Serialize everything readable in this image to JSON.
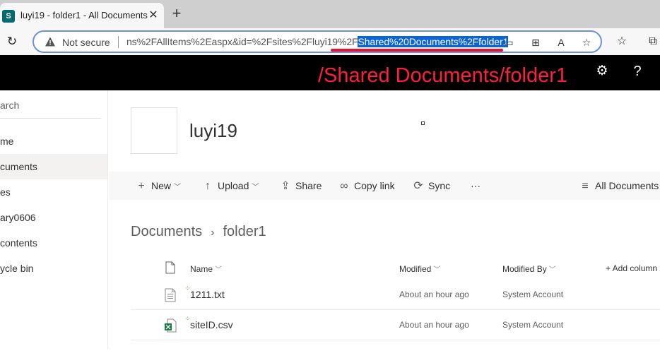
{
  "browser": {
    "tab_title": "luyi19 - folder1 - All Documents",
    "favicon_letter": "S",
    "tab_close": "✕",
    "new_tab": "+",
    "reload": "↻",
    "security_label": "Not secure",
    "url_prefix": "ns%2FAllItems%2Easpx&id=%2Fsites%2Fluyi19%2F",
    "url_highlight": "Shared%20Documents%2Ffolder1",
    "icons": [
      "warning-icon",
      "cast-icon",
      "apps-icon",
      "read-aloud-icon",
      "favorite-add-icon",
      "favorites-icon",
      "collections-icon"
    ]
  },
  "annotation": {
    "path_overlay": "/Shared Documents/folder1",
    "color": "#e8132f"
  },
  "suitebar": {
    "gear": "⚙",
    "help": "?"
  },
  "leftnav": {
    "search": "arch",
    "items": [
      {
        "label": "me",
        "selected": false
      },
      {
        "label": "cuments",
        "selected": true
      },
      {
        "label": "es",
        "selected": false
      },
      {
        "label": "ary0606",
        "selected": false
      },
      {
        "label": " contents",
        "selected": false
      },
      {
        "label": "ycle bin",
        "selected": false
      }
    ]
  },
  "site": {
    "title": "luyi19"
  },
  "commands": {
    "new": "New",
    "upload": "Upload",
    "share": "Share",
    "copy_link": "Copy link",
    "sync": "Sync",
    "more": "···",
    "view": "All Documents"
  },
  "breadcrumb": {
    "root": "Documents",
    "separator": "›",
    "current": "folder1"
  },
  "list": {
    "columns": {
      "name": "Name",
      "modified": "Modified",
      "modified_by": "Modified By",
      "add_column": "+ Add column"
    },
    "rows": [
      {
        "name": "1211.txt",
        "modified": "About an hour ago",
        "modified_by": "System Account",
        "type": "txt"
      },
      {
        "name": "siteID.csv",
        "modified": "About an hour ago",
        "modified_by": "System Account",
        "type": "csv"
      }
    ]
  },
  "colors": {
    "suitebar": "#000000",
    "address_border": "#6f8fd9",
    "highlight": "#0a64d6",
    "excel_green": "#107c41"
  }
}
